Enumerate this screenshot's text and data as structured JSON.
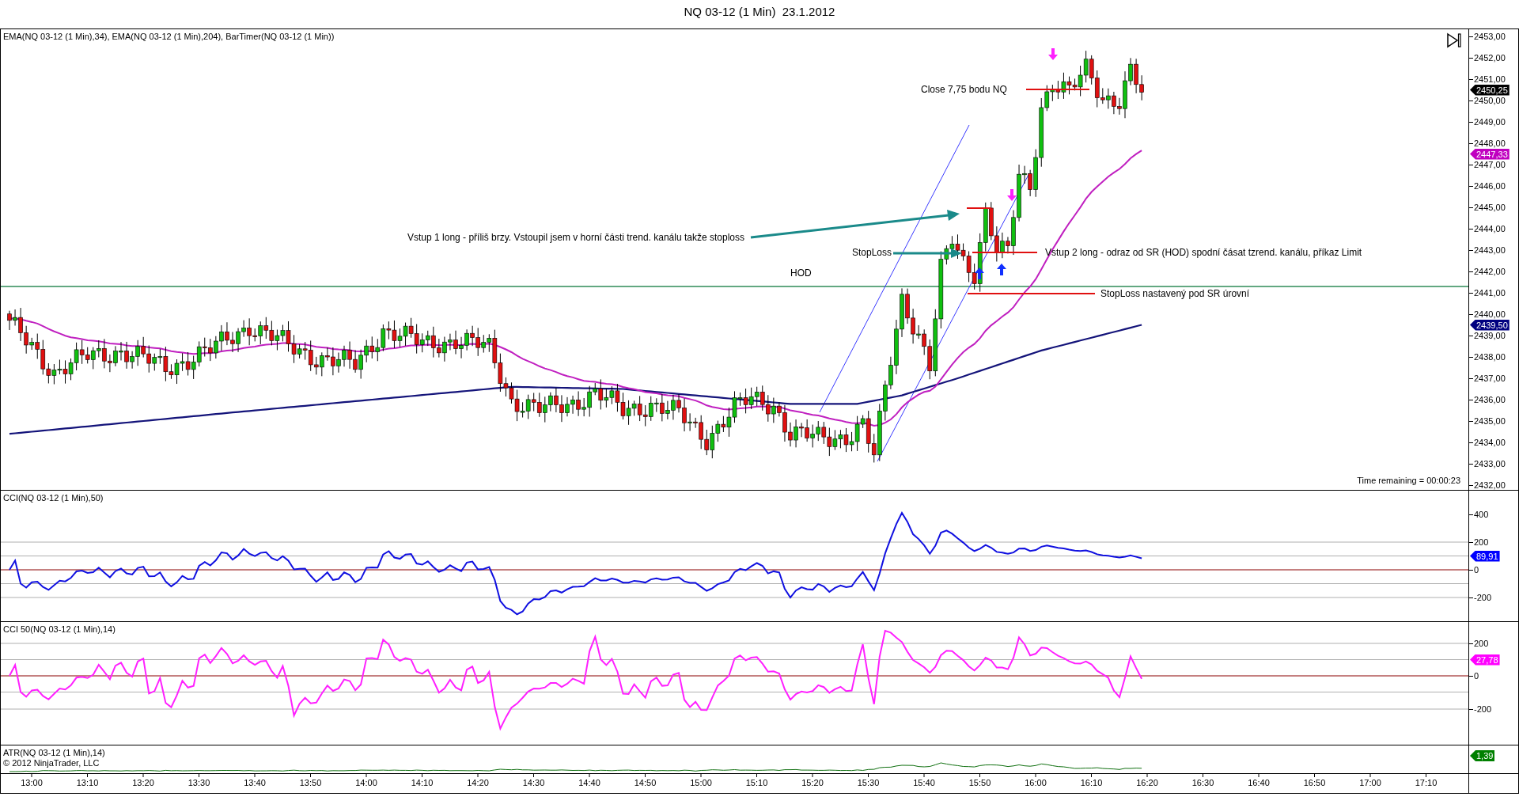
{
  "window": {
    "title": "NQ 03-12 (1 Min)  23.1.2012"
  },
  "panels": [
    {
      "kind": "price",
      "label": "EMA(NQ 03-12 (1 Min),34), EMA(NQ 03-12 (1 Min),204), BarTimer(NQ 03-12 (1 Min))",
      "ticks": [
        "2453,00",
        "2452,00",
        "2451,00",
        "2450,00",
        "2449,00",
        "2448,00",
        "2447,00",
        "2446,00",
        "2445,00",
        "2444,00",
        "2443,00",
        "2442,00",
        "2441,00",
        "2440,00",
        "2439,00",
        "2438,00",
        "2437,00",
        "2436,00",
        "2435,00",
        "2434,00",
        "2433,00",
        "2432,00"
      ],
      "tags": [
        {
          "text": "2450,25",
          "color": "#000000"
        },
        {
          "text": "2447,33",
          "color": "#c000c0"
        },
        {
          "text": "2439,50",
          "color": "#000080"
        }
      ],
      "annotations": [
        "Close 7,75 bodu NQ",
        "Vstup 1 long - příliš brzy. Vstoupil jsem v horní části trend. kanálu takže stoploss",
        "StopLoss",
        "Vstup 2 long - odraz od SR (HOD) spodní čásat tzrend. kanálu, příkaz Limit",
        "HOD",
        "StopLoss nastavený pod SR úrovní"
      ],
      "timer": "Time remaining = 00:00:23"
    },
    {
      "kind": "cci",
      "label": "CCI(NQ 03-12 (1 Min),50)",
      "ticks": [
        "400",
        "200",
        "0",
        "-200"
      ],
      "tags": [
        {
          "text": "89,91",
          "color": "#0000ff"
        }
      ]
    },
    {
      "kind": "cci50",
      "label": "CCI 50(NQ 03-12 (1 Min),14)",
      "ticks": [
        "200",
        "0",
        "-200"
      ],
      "tags": [
        {
          "text": "27,78",
          "color": "#ff00ff"
        }
      ]
    },
    {
      "kind": "atr",
      "label": "ATR(NQ 03-12 (1 Min),14)",
      "copyright": "© 2012 NinjaTrader, LLC",
      "tags": [
        {
          "text": "1,39",
          "color": "#008000"
        }
      ]
    }
  ],
  "time_axis": [
    "13:00",
    "13:10",
    "13:20",
    "13:30",
    "13:40",
    "13:50",
    "14:00",
    "14:10",
    "14:20",
    "14:30",
    "14:40",
    "14:50",
    "15:00",
    "15:10",
    "15:20",
    "15:30",
    "15:40",
    "15:50",
    "16:00",
    "16:10",
    "16:20",
    "16:30",
    "16:40",
    "16:50",
    "17:00",
    "17:10"
  ]
}
